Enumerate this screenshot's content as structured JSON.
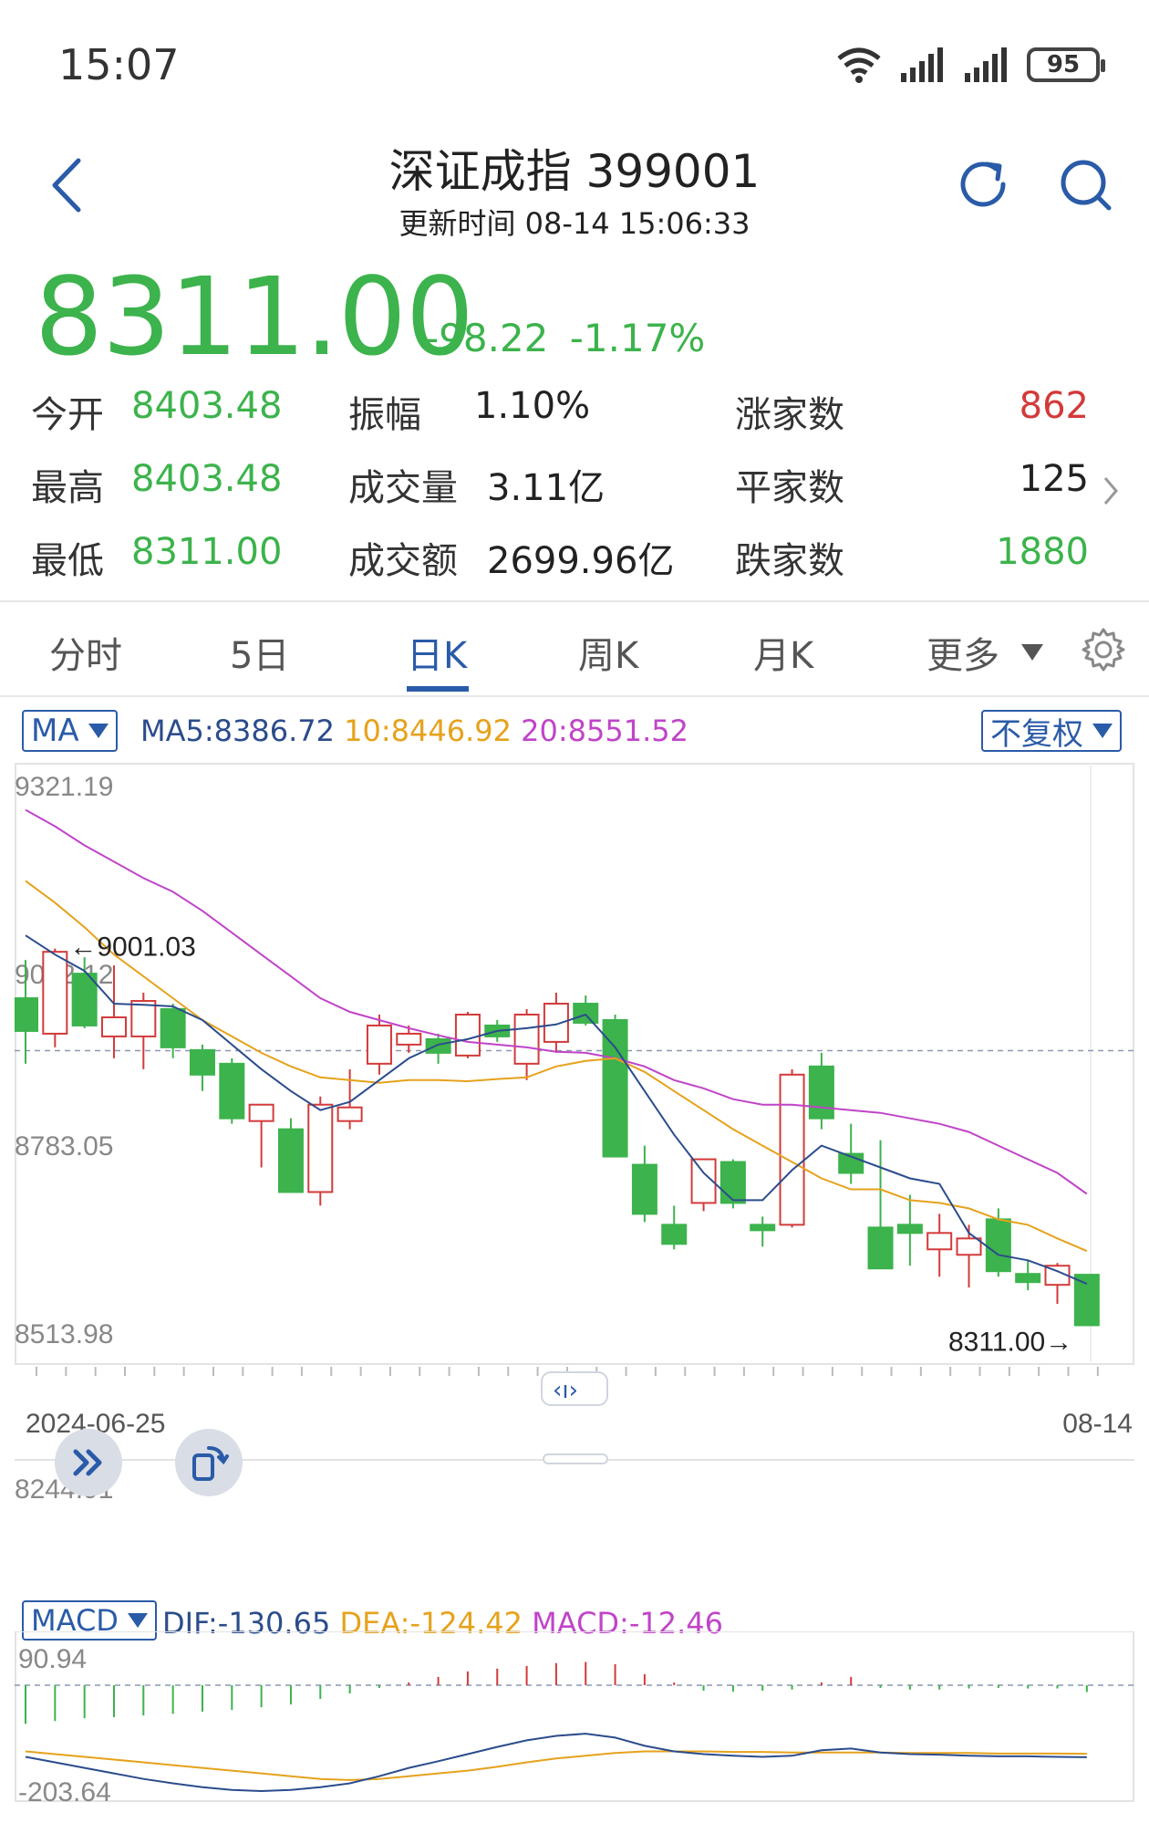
{
  "status_bar": {
    "time": "15:07",
    "battery": "95",
    "icons": [
      "wifi-icon",
      "signal-icon",
      "signal-icon",
      "battery-icon"
    ]
  },
  "header": {
    "title": "深证成指 399001",
    "subtitle": "更新时间 08-14 15:06:33"
  },
  "quote": {
    "price": "8311.00",
    "change": "-98.22",
    "change_pct": "-1.17%"
  },
  "stats": {
    "open": {
      "label": "今开",
      "value": "8403.48"
    },
    "high": {
      "label": "最高",
      "value": "8403.48"
    },
    "low": {
      "label": "最低",
      "value": "8311.00"
    },
    "amplitude": {
      "label": "振幅",
      "value": "1.10%"
    },
    "volume": {
      "label": "成交量",
      "value": "3.11亿"
    },
    "turnover": {
      "label": "成交额",
      "value": "2699.96亿"
    },
    "up_count": {
      "label": "涨家数",
      "value": "862"
    },
    "flat_count": {
      "label": "平家数",
      "value": "125"
    },
    "down_count": {
      "label": "跌家数",
      "value": "1880"
    }
  },
  "tabs": [
    {
      "label": "分时"
    },
    {
      "label": "5日"
    },
    {
      "label": "日K"
    },
    {
      "label": "周K"
    },
    {
      "label": "月K"
    },
    {
      "label": "更多"
    }
  ],
  "kline_header": {
    "indicator": "MA",
    "ma5": "MA5:8386.72",
    "ma10": "10:8446.92",
    "ma20": "20:8551.52",
    "adjust": "不复权"
  },
  "colors": {
    "up": "#d33a3a",
    "down": "#3cb34c",
    "accent": "#2a5ba8",
    "ma5": "#2b4c8c",
    "ma10": "#e6a21c",
    "ma20": "#c044c8"
  },
  "chart_data": [
    {
      "type": "candlestick",
      "y_ticks": [
        "9321.19",
        "9052.12",
        "8783.05",
        "8513.98",
        "8244.91"
      ],
      "ylim": [
        8244.91,
        9321.19
      ],
      "x_labels": [
        "2024-06-25",
        "08-14"
      ],
      "annotations": {
        "max": "←9001.03",
        "min": "8311.00→"
      },
      "reference_line": 8814,
      "candles": [
        {
          "o": 8910,
          "h": 8980,
          "l": 8790,
          "c": 8850
        },
        {
          "o": 8845,
          "h": 9001.03,
          "l": 8820,
          "c": 8995
        },
        {
          "o": 8955,
          "h": 8985,
          "l": 8855,
          "c": 8860
        },
        {
          "o": 8840,
          "h": 8970,
          "l": 8800,
          "c": 8875
        },
        {
          "o": 8840,
          "h": 8920,
          "l": 8780,
          "c": 8905
        },
        {
          "o": 8890,
          "h": 8900,
          "l": 8800,
          "c": 8820
        },
        {
          "o": 8815,
          "h": 8825,
          "l": 8740,
          "c": 8770
        },
        {
          "o": 8790,
          "h": 8800,
          "l": 8680,
          "c": 8690
        },
        {
          "o": 8685,
          "h": 8710,
          "l": 8600,
          "c": 8715
        },
        {
          "o": 8670,
          "h": 8690,
          "l": 8560,
          "c": 8555
        },
        {
          "o": 8555,
          "h": 8730,
          "l": 8530,
          "c": 8715
        },
        {
          "o": 8685,
          "h": 8780,
          "l": 8670,
          "c": 8710
        },
        {
          "o": 8790,
          "h": 8880,
          "l": 8770,
          "c": 8860
        },
        {
          "o": 8825,
          "h": 8860,
          "l": 8810,
          "c": 8845
        },
        {
          "o": 8835,
          "h": 8845,
          "l": 8790,
          "c": 8810
        },
        {
          "o": 8805,
          "h": 8885,
          "l": 8800,
          "c": 8880
        },
        {
          "o": 8860,
          "h": 8870,
          "l": 8830,
          "c": 8840
        },
        {
          "o": 8790,
          "h": 8890,
          "l": 8760,
          "c": 8880
        },
        {
          "o": 8830,
          "h": 8920,
          "l": 8810,
          "c": 8900
        },
        {
          "o": 8900,
          "h": 8915,
          "l": 8860,
          "c": 8865
        },
        {
          "o": 8870,
          "h": 8880,
          "l": 8620,
          "c": 8620
        },
        {
          "o": 8605,
          "h": 8640,
          "l": 8500,
          "c": 8515
        },
        {
          "o": 8495,
          "h": 8530,
          "l": 8450,
          "c": 8460
        },
        {
          "o": 8535,
          "h": 8610,
          "l": 8520,
          "c": 8615
        },
        {
          "o": 8610,
          "h": 8615,
          "l": 8525,
          "c": 8535
        },
        {
          "o": 8495,
          "h": 8510,
          "l": 8455,
          "c": 8485
        },
        {
          "o": 8495,
          "h": 8780,
          "l": 8490,
          "c": 8770
        },
        {
          "o": 8785,
          "h": 8810,
          "l": 8670,
          "c": 8690
        },
        {
          "o": 8625,
          "h": 8680,
          "l": 8570,
          "c": 8590
        },
        {
          "o": 8490,
          "h": 8650,
          "l": 8420,
          "c": 8415
        },
        {
          "o": 8495,
          "h": 8550,
          "l": 8420,
          "c": 8480
        },
        {
          "o": 8450,
          "h": 8515,
          "l": 8400,
          "c": 8480
        },
        {
          "o": 8440,
          "h": 8495,
          "l": 8380,
          "c": 8470
        },
        {
          "o": 8505,
          "h": 8525,
          "l": 8400,
          "c": 8410
        },
        {
          "o": 8405,
          "h": 8430,
          "l": 8375,
          "c": 8390
        },
        {
          "o": 8385,
          "h": 8425,
          "l": 8350,
          "c": 8420
        },
        {
          "o": 8403.48,
          "h": 8403.48,
          "l": 8311.0,
          "c": 8311.0
        }
      ],
      "ma5": [
        9025,
        8990,
        8960,
        8900,
        8898,
        8895,
        8870,
        8825,
        8780,
        8740,
        8705,
        8720,
        8760,
        8800,
        8825,
        8835,
        8850,
        8855,
        8862,
        8880,
        8820,
        8740,
        8660,
        8590,
        8540,
        8540,
        8595,
        8640,
        8620,
        8600,
        8580,
        8570,
        8480,
        8440,
        8430,
        8410,
        8386.72
      ],
      "ma10": [
        9125,
        9085,
        9040,
        8990,
        8950,
        8910,
        8870,
        8840,
        8810,
        8785,
        8765,
        8760,
        8755,
        8760,
        8760,
        8758,
        8762,
        8765,
        8785,
        8795,
        8800,
        8775,
        8740,
        8705,
        8670,
        8640,
        8610,
        8580,
        8560,
        8560,
        8540,
        8535,
        8525,
        8505,
        8495,
        8470,
        8446.92
      ],
      "ma20": [
        9255,
        9225,
        9190,
        9160,
        9130,
        9105,
        9070,
        9030,
        8990,
        8950,
        8910,
        8885,
        8870,
        8855,
        8842,
        8830,
        8825,
        8820,
        8812,
        8810,
        8800,
        8785,
        8760,
        8745,
        8725,
        8715,
        8715,
        8710,
        8705,
        8700,
        8690,
        8680,
        8665,
        8640,
        8615,
        8590,
        8551.52
      ]
    },
    {
      "type": "macd",
      "indicator": "MACD",
      "dif_label": "DIF:-130.65",
      "dea_label": "DEA:-124.42",
      "macd_label": "MACD:-12.46",
      "y_ticks": [
        "90.94",
        "-203.64"
      ],
      "ylim": [
        -203.64,
        90.94
      ],
      "histogram": [
        -70,
        -65,
        -60,
        -58,
        -55,
        -52,
        -48,
        -45,
        -40,
        -35,
        -25,
        -15,
        -5,
        5,
        15,
        25,
        30,
        35,
        40,
        42,
        38,
        20,
        5,
        -10,
        -12,
        -10,
        -8,
        5,
        15,
        -5,
        -8,
        -8,
        -6,
        -5,
        -6,
        -6,
        -12.46
      ],
      "dif": [
        -130,
        -140,
        -150,
        -160,
        -170,
        -178,
        -185,
        -190,
        -192,
        -190,
        -185,
        -178,
        -165,
        -150,
        -138,
        -125,
        -112,
        -100,
        -92,
        -88,
        -95,
        -110,
        -120,
        -125,
        -128,
        -130,
        -128,
        -118,
        -115,
        -122,
        -125,
        -126,
        -128,
        -129,
        -129,
        -130,
        -130.65
      ],
      "dea": [
        -120,
        -125,
        -130,
        -135,
        -140,
        -145,
        -150,
        -155,
        -160,
        -165,
        -170,
        -172,
        -170,
        -165,
        -160,
        -155,
        -148,
        -140,
        -133,
        -128,
        -123,
        -120,
        -120,
        -120,
        -121,
        -121,
        -122,
        -122,
        -122,
        -122,
        -123,
        -123,
        -123,
        -124,
        -124,
        -124,
        -124.42
      ]
    }
  ]
}
